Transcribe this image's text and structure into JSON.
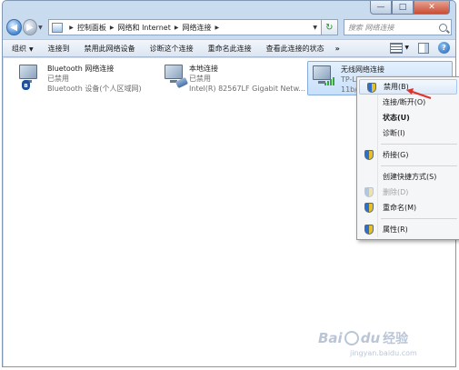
{
  "address_bar": {
    "crumbs": [
      "控制面板",
      "网络和 Internet",
      "网络连接"
    ]
  },
  "search": {
    "placeholder": "搜索 网络连接"
  },
  "commandbar": {
    "organize": "组织",
    "connect_to": "连接到",
    "disable_device": "禁用此网络设备",
    "diagnose": "诊断这个连接",
    "rename": "重命名此连接",
    "view_status": "查看此连接的状态",
    "more": "»"
  },
  "connections": [
    {
      "name": "Bluetooth 网络连接",
      "status": "已禁用",
      "device": "Bluetooth 设备(个人区域网)",
      "icon": "bluetooth-network-icon"
    },
    {
      "name": "本地连接",
      "status": "已禁用",
      "device": "Intel(R) 82567LF Gigabit Netw...",
      "icon": "ethernet-network-icon"
    },
    {
      "name": "无线网络连接",
      "status": "TP-LINK",
      "device": "11b/g",
      "icon": "wireless-network-icon"
    }
  ],
  "context_menu": {
    "items": [
      {
        "label": "禁用(B)",
        "shield": true,
        "highlighted": true
      },
      {
        "label": "连接/断开(O)",
        "shield": false
      },
      {
        "label": "状态(U)",
        "shield": false,
        "bold": true
      },
      {
        "label": "诊断(I)",
        "shield": false
      },
      {
        "label": "桥接(G)",
        "shield": true
      },
      {
        "label": "创建快捷方式(S)",
        "shield": false
      },
      {
        "label": "删除(D)",
        "shield": true,
        "disabled": true
      },
      {
        "label": "重命名(M)",
        "shield": true
      },
      {
        "label": "属性(R)",
        "shield": true
      }
    ]
  },
  "watermark": {
    "brand": "Bai",
    "brand2": "du",
    "cn": "经验",
    "url": "jingyan.baidu.com"
  },
  "colors": {
    "frame": "#c9dbee",
    "selection": "#c8e0fa",
    "annotation_arrow": "#e0322a"
  }
}
